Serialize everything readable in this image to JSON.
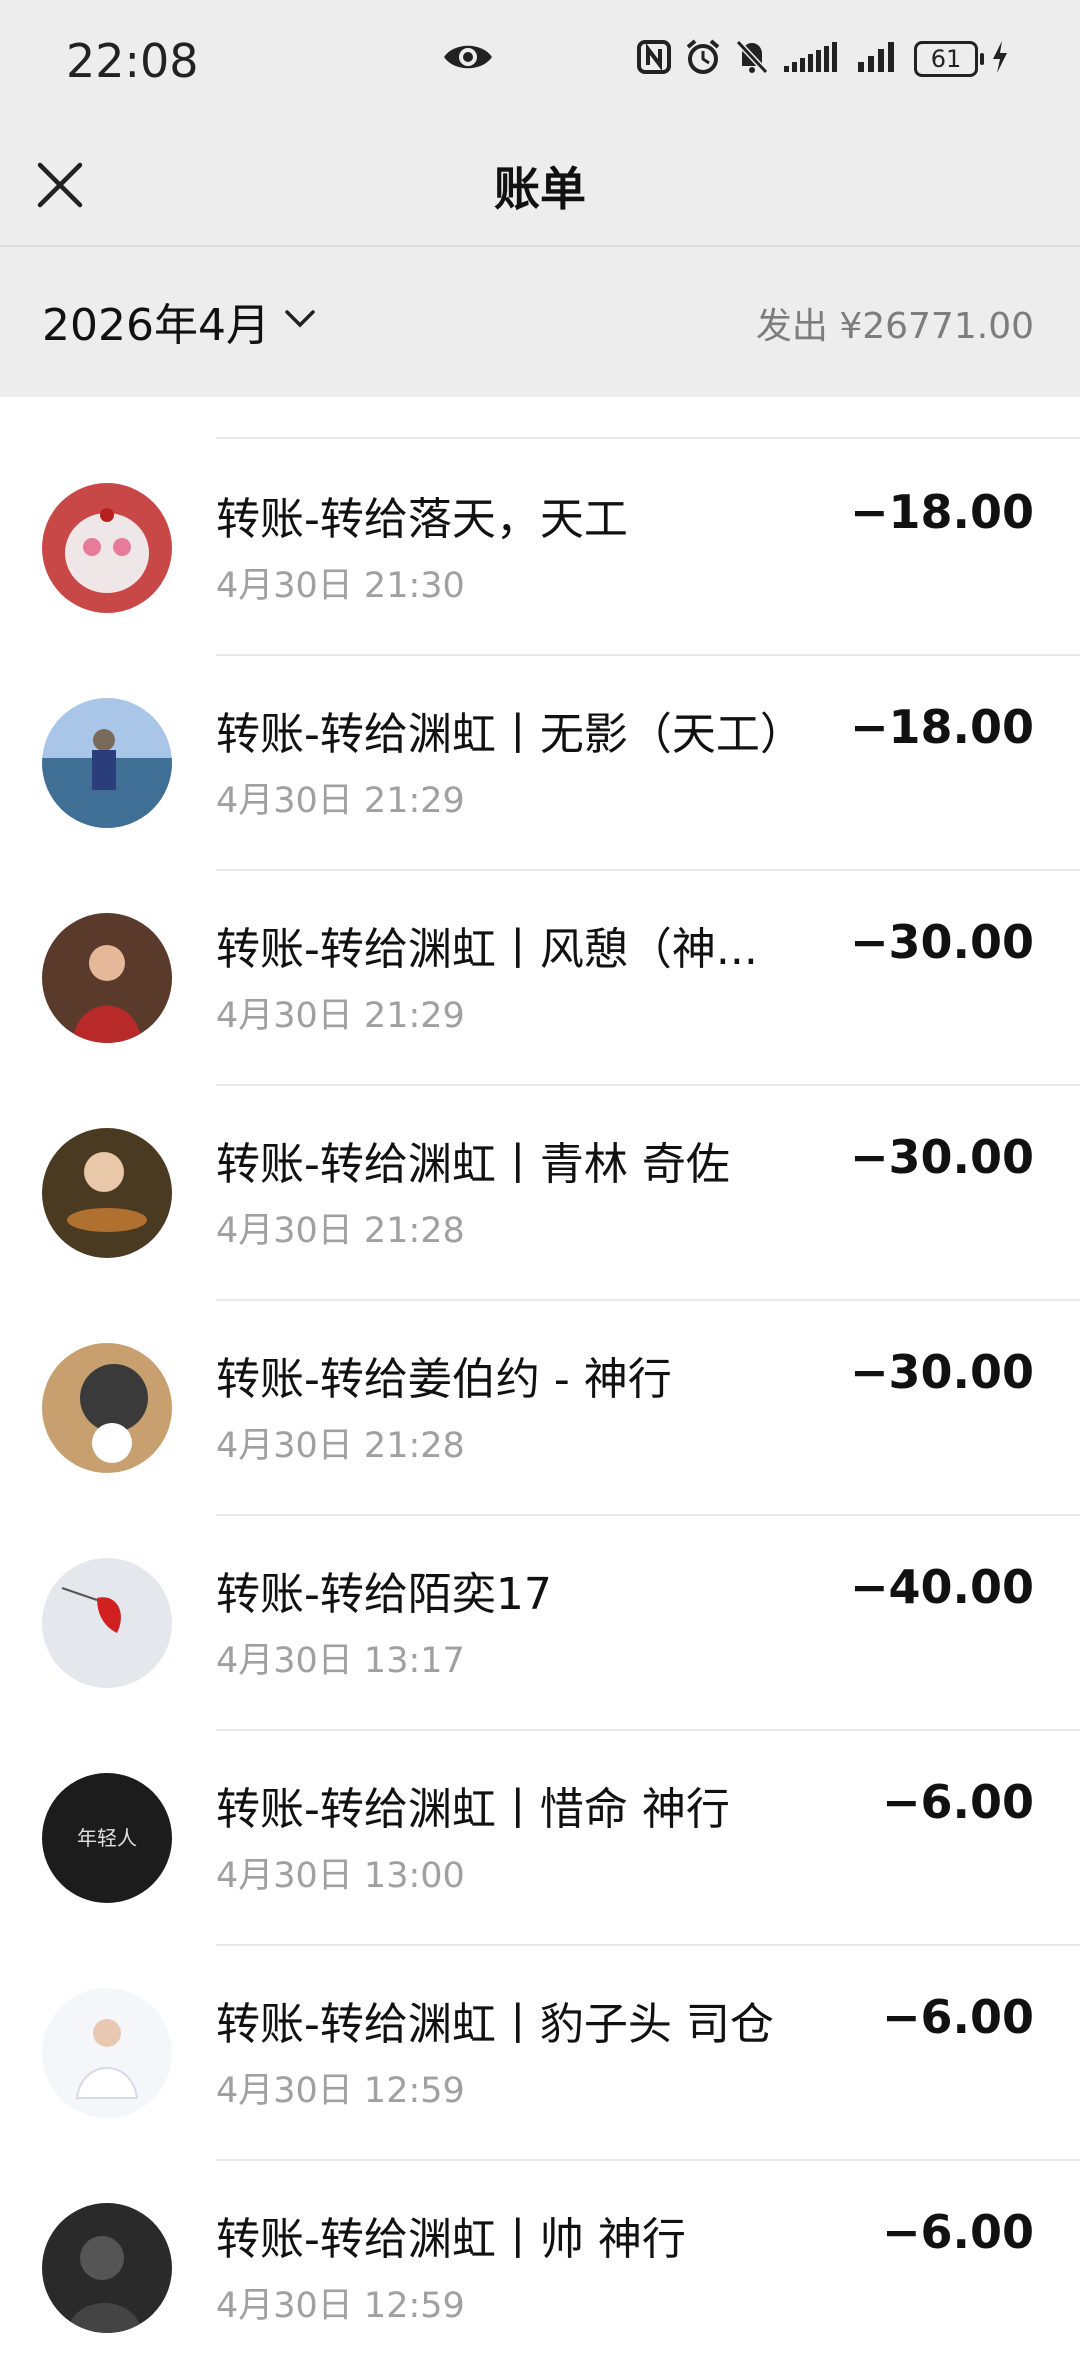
{
  "status_bar": {
    "time": "22:08",
    "battery": "61",
    "icons": [
      "eye-icon",
      "nfc-icon",
      "alarm-icon",
      "mute-icon",
      "signal-icon",
      "signal-icon",
      "battery-icon",
      "charging-icon"
    ]
  },
  "header": {
    "title": "账单",
    "close_icon": "close-icon"
  },
  "filter": {
    "month": "2026年4月",
    "summary": "发出 ¥26771.00"
  },
  "transactions": [
    {
      "title": "转账-转给落天，天工",
      "time": "4月30日 21:30",
      "amount": "−18.00"
    },
    {
      "title": "转账-转给渊虹丨无影（天工）",
      "time": "4月30日 21:29",
      "amount": "−18.00"
    },
    {
      "title": "转账-转给渊虹丨风憩（神...",
      "time": "4月30日 21:29",
      "amount": "−30.00"
    },
    {
      "title": "转账-转给渊虹丨青林 奇佐",
      "time": "4月30日 21:28",
      "amount": "−30.00"
    },
    {
      "title": "转账-转给姜伯约 - 神行",
      "time": "4月30日 21:28",
      "amount": "−30.00"
    },
    {
      "title": "转账-转给陌奕17",
      "time": "4月30日 13:17",
      "amount": "−40.00"
    },
    {
      "title": "转账-转给渊虹丨惜命 神行",
      "time": "4月30日 13:00",
      "amount": "−6.00"
    },
    {
      "title": "转账-转给渊虹丨豹子头 司仓",
      "time": "4月30日 12:59",
      "amount": "−6.00"
    },
    {
      "title": "转账-转给渊虹丨帅 神行",
      "time": "4月30日 12:59",
      "amount": "−6.00"
    }
  ],
  "avatar_text": "年轻人"
}
